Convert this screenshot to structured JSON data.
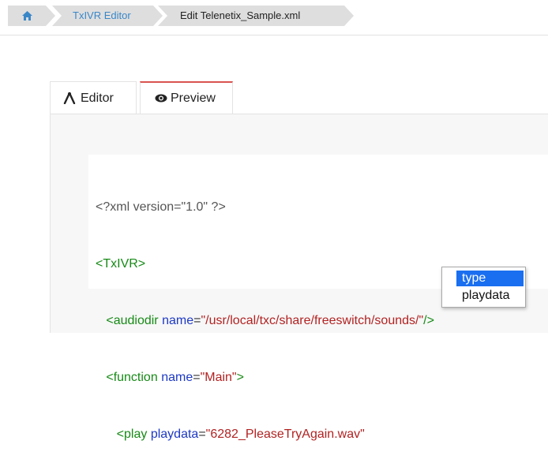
{
  "breadcrumb": {
    "home_icon": "home-icon",
    "items": [
      {
        "label": "TxIVR Editor"
      },
      {
        "label": "Edit  Telenetix_Sample.xml"
      }
    ]
  },
  "tabs": [
    {
      "label": "Editor",
      "icon": "editor-icon",
      "active": false
    },
    {
      "label": "Preview",
      "icon": "eye-icon",
      "active": true
    }
  ],
  "colors": {
    "active_tab_border": "#d9534f",
    "tag": "#178a17",
    "attribute": "#1d39c4",
    "value": "#b22222",
    "selection": "#1a6ff0"
  },
  "code": {
    "line1": "<?xml version=\"1.0\" ?>",
    "line2_tag": "<TxIVR>",
    "line3": {
      "open": "<audiodir",
      "attr": "name",
      "eq": "=",
      "value": "\"/usr/local/txc/share/freeswitch/sounds/\"",
      "close": "/>"
    },
    "line4": {
      "open": "<function",
      "attr": "name",
      "eq": "=",
      "value": "\"Main\"",
      "close": ">"
    },
    "line5": {
      "open": "<play",
      "attr": "playdata",
      "eq": "=",
      "value": "\"6282_PleaseTryAgain.wav\""
    }
  },
  "autocomplete": {
    "items": [
      "type",
      "playdata"
    ],
    "selected": "type"
  }
}
